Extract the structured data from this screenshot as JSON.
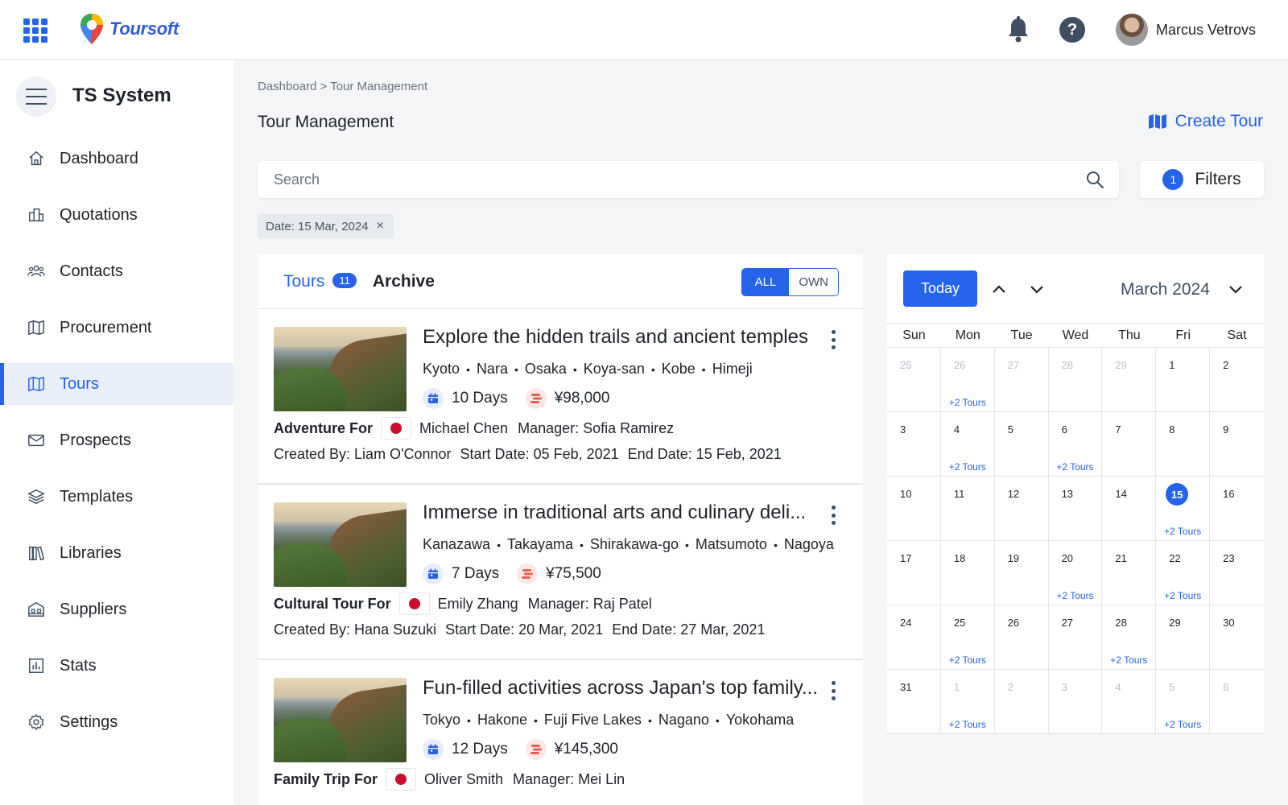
{
  "app": {
    "logo_text": "Toursoft",
    "user_name": "Marcus Vetrovs",
    "help_glyph": "?"
  },
  "colors": {
    "accent": "#2563eb",
    "flag_red": "#c8102e",
    "text": "#1f2329"
  },
  "sidebar": {
    "title": "TS System",
    "items": [
      {
        "label": "Dashboard",
        "icon": "home-icon",
        "active": false
      },
      {
        "label": "Quotations",
        "icon": "quotations-icon",
        "active": false
      },
      {
        "label": "Contacts",
        "icon": "contacts-icon",
        "active": false
      },
      {
        "label": "Procurement",
        "icon": "map-icon",
        "active": false
      },
      {
        "label": "Tours",
        "icon": "map-icon",
        "active": true
      },
      {
        "label": "Prospects",
        "icon": "mail-icon",
        "active": false
      },
      {
        "label": "Templates",
        "icon": "layers-icon",
        "active": false
      },
      {
        "label": "Libraries",
        "icon": "library-icon",
        "active": false
      },
      {
        "label": "Suppliers",
        "icon": "building-icon",
        "active": false
      },
      {
        "label": "Stats",
        "icon": "stats-icon",
        "active": false
      },
      {
        "label": "Settings",
        "icon": "gear-icon",
        "active": false
      }
    ]
  },
  "main": {
    "breadcrumb": "Dashboard > Tour Management",
    "title": "Tour Management",
    "create_label": "Create Tour",
    "search_placeholder": "Search",
    "filters_label": "Filters",
    "filters_count": "1",
    "chip_label": "Date: 15 Mar, 2024",
    "chip_close": "×"
  },
  "list": {
    "tab_tours": "Tours",
    "tours_count": "11",
    "tab_archive": "Archive",
    "seg_all": "ALL",
    "seg_own": "OWN",
    "tours": [
      {
        "title": "Explore the hidden trails and ancient temples",
        "cities": [
          "Kyoto",
          "Nara",
          "Osaka",
          "Koya-san",
          "Kobe",
          "Himeji"
        ],
        "days": "10 Days",
        "price": "¥98,000",
        "type": "Adventure For",
        "client": "Michael Chen",
        "manager": "Manager: Sofia Ramirez",
        "created_by": "Created By: Liam O'Connor",
        "start": "Start Date: 05 Feb, 2021",
        "end": "End Date: 15 Feb, 2021"
      },
      {
        "title": "Immerse in traditional arts and culinary deli...",
        "cities": [
          "Kanazawa",
          "Takayama",
          "Shirakawa-go",
          "Matsumoto",
          "Nagoya"
        ],
        "days": "7 Days",
        "price": "¥75,500",
        "type": "Cultural Tour For",
        "client": "Emily Zhang",
        "manager": "Manager: Raj Patel",
        "created_by": "Created By: Hana Suzuki",
        "start": "Start Date: 20 Mar, 2021",
        "end": "End Date: 27 Mar, 2021"
      },
      {
        "title": "Fun-filled activities across Japan's top family...",
        "cities": [
          "Tokyo",
          "Hakone",
          "Fuji Five Lakes",
          "Nagano",
          "Yokohama"
        ],
        "days": "12 Days",
        "price": "¥145,300",
        "type": "Family Trip For",
        "client": "Oliver Smith",
        "manager": "Manager: Mei Lin",
        "created_by": "",
        "start": "",
        "end": ""
      }
    ]
  },
  "calendar": {
    "today_label": "Today",
    "month_label": "March 2024",
    "weekdays": [
      "Sun",
      "Mon",
      "Tue",
      "Wed",
      "Thu",
      "Fri",
      "Sat"
    ],
    "cells": [
      {
        "day": "25",
        "muted": true,
        "tours": ""
      },
      {
        "day": "26",
        "muted": true,
        "tours": "+2 Tours"
      },
      {
        "day": "27",
        "muted": true,
        "tours": ""
      },
      {
        "day": "28",
        "muted": true,
        "tours": ""
      },
      {
        "day": "29",
        "muted": true,
        "tours": ""
      },
      {
        "day": "1",
        "muted": false,
        "tours": ""
      },
      {
        "day": "2",
        "muted": false,
        "tours": ""
      },
      {
        "day": "3",
        "muted": false,
        "tours": ""
      },
      {
        "day": "4",
        "muted": false,
        "tours": "+2 Tours"
      },
      {
        "day": "5",
        "muted": false,
        "tours": ""
      },
      {
        "day": "6",
        "muted": false,
        "tours": "+2 Tours"
      },
      {
        "day": "7",
        "muted": false,
        "tours": ""
      },
      {
        "day": "8",
        "muted": false,
        "tours": ""
      },
      {
        "day": "9",
        "muted": false,
        "tours": ""
      },
      {
        "day": "10",
        "muted": false,
        "tours": ""
      },
      {
        "day": "11",
        "muted": false,
        "tours": ""
      },
      {
        "day": "12",
        "muted": false,
        "tours": ""
      },
      {
        "day": "13",
        "muted": false,
        "tours": ""
      },
      {
        "day": "14",
        "muted": false,
        "tours": ""
      },
      {
        "day": "15",
        "muted": false,
        "tours": "+2 Tours",
        "today": true
      },
      {
        "day": "16",
        "muted": false,
        "tours": ""
      },
      {
        "day": "17",
        "muted": false,
        "tours": ""
      },
      {
        "day": "18",
        "muted": false,
        "tours": ""
      },
      {
        "day": "19",
        "muted": false,
        "tours": ""
      },
      {
        "day": "20",
        "muted": false,
        "tours": "+2 Tours"
      },
      {
        "day": "21",
        "muted": false,
        "tours": ""
      },
      {
        "day": "22",
        "muted": false,
        "tours": "+2 Tours"
      },
      {
        "day": "23",
        "muted": false,
        "tours": ""
      },
      {
        "day": "24",
        "muted": false,
        "tours": ""
      },
      {
        "day": "25",
        "muted": false,
        "tours": "+2 Tours"
      },
      {
        "day": "26",
        "muted": false,
        "tours": ""
      },
      {
        "day": "27",
        "muted": false,
        "tours": ""
      },
      {
        "day": "28",
        "muted": false,
        "tours": "+2 Tours"
      },
      {
        "day": "29",
        "muted": false,
        "tours": ""
      },
      {
        "day": "30",
        "muted": false,
        "tours": ""
      },
      {
        "day": "31",
        "muted": false,
        "tours": ""
      },
      {
        "day": "1",
        "muted": true,
        "tours": "+2 Tours"
      },
      {
        "day": "2",
        "muted": true,
        "tours": ""
      },
      {
        "day": "3",
        "muted": true,
        "tours": ""
      },
      {
        "day": "4",
        "muted": true,
        "tours": ""
      },
      {
        "day": "5",
        "muted": true,
        "tours": "+2 Tours"
      },
      {
        "day": "6",
        "muted": true,
        "tours": ""
      }
    ]
  }
}
